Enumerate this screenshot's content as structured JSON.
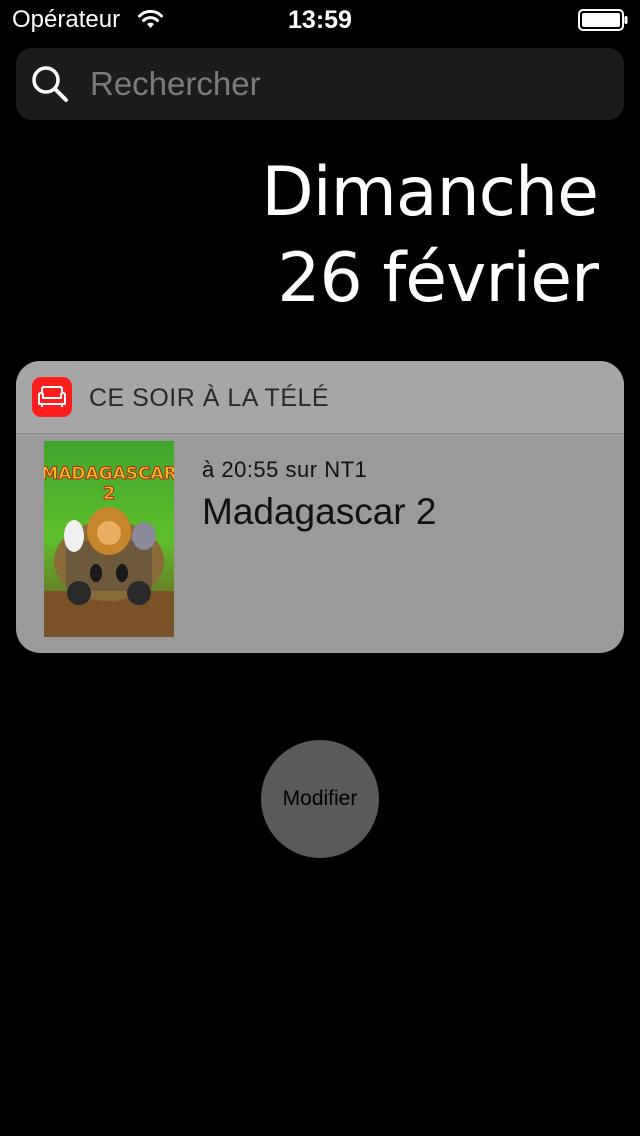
{
  "status_bar": {
    "carrier": "Opérateur",
    "time": "13:59",
    "wifi_icon": "wifi-icon",
    "battery_icon": "battery-full-icon"
  },
  "search": {
    "placeholder": "Rechercher",
    "icon": "search-icon"
  },
  "date": {
    "weekday": "Dimanche",
    "day_month": "26 février"
  },
  "widget": {
    "app_icon": "sofa-icon",
    "app_icon_color": "#ff1e1e",
    "title": "CE SOIR À LA TÉLÉ",
    "program": {
      "time_channel": "à 20:55 sur NT1",
      "title": "Madagascar 2",
      "poster_title": "MADAGASCAR",
      "poster_number": "2"
    }
  },
  "edit_button": {
    "label": "Modifier"
  }
}
